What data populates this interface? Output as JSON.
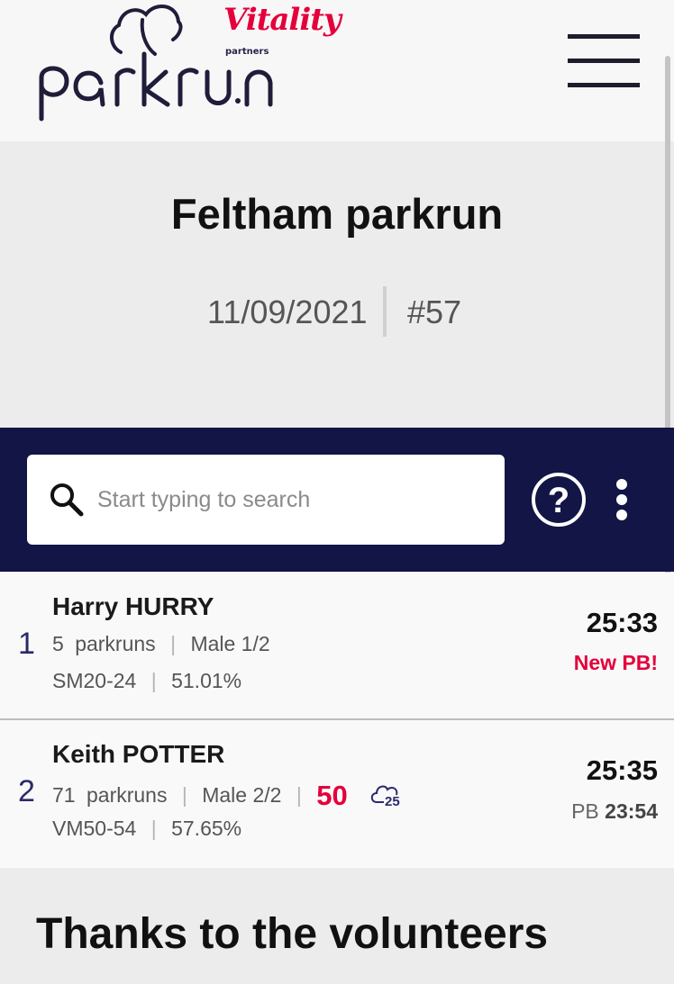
{
  "header": {
    "brand_sponsor": "Vitality",
    "brand_partners": "partners",
    "brand_name": "parkrun",
    "menu_icon": "hamburger-menu-icon"
  },
  "event": {
    "title": "Feltham parkrun",
    "date": "11/09/2021",
    "number": "#57"
  },
  "search": {
    "placeholder": "Start typing to search",
    "value": "",
    "icon": "search-icon",
    "help_icon": "question-circle-icon",
    "more_icon": "vertical-ellipsis-icon"
  },
  "results": [
    {
      "position": "1",
      "name": "Harry HURRY",
      "parkruns": "5",
      "parkruns_label": "parkruns",
      "gender_position": "Male 1/2",
      "age_category": "SM20-24",
      "age_grade": "51.01%",
      "time": "25:33",
      "pb_note": "New PB!"
    },
    {
      "position": "2",
      "name": "Keith POTTER",
      "parkruns": "71",
      "parkruns_label": "parkruns",
      "gender_position": "Male 2/2",
      "milestone": "50",
      "volunteer_milestone": "25",
      "age_category": "VM50-54",
      "age_grade": "57.65%",
      "time": "25:35",
      "pb_label": "PB",
      "pb_time": "23:54"
    }
  ],
  "volunteers": {
    "title": "Thanks to the volunteers"
  },
  "colors": {
    "brand_red": "#e4003b",
    "navy": "#131546",
    "position_blue": "#2a2a6a"
  }
}
